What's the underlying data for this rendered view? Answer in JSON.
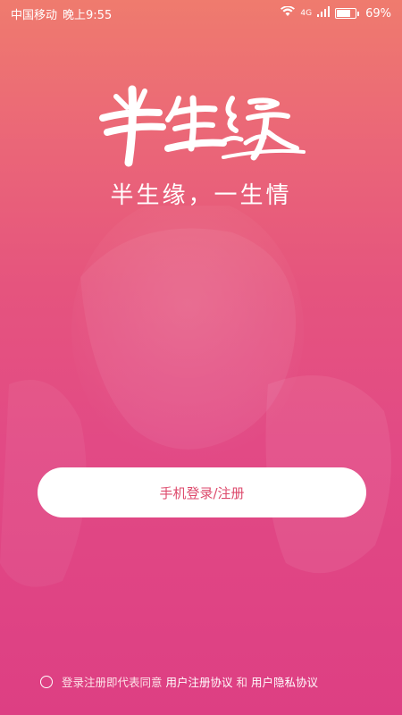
{
  "status_bar": {
    "carrier": "中国移动",
    "time": "晚上9:55",
    "network": "4G",
    "battery": "69%"
  },
  "logo": {
    "text": "半生缘",
    "icon": "app-logo-calligraphy"
  },
  "slogan": "半生缘，一生情",
  "login_button": {
    "label": "手机登录/注册"
  },
  "agreement": {
    "prefix": "登录注册即代表同意",
    "user_agreement": "用户注册协议",
    "conjunction": "和",
    "privacy_policy": "用户隐私协议"
  },
  "colors": {
    "gradient_top": "#ef7b6e",
    "gradient_bottom": "#dd3f83",
    "button_text": "#dd4a6c"
  }
}
